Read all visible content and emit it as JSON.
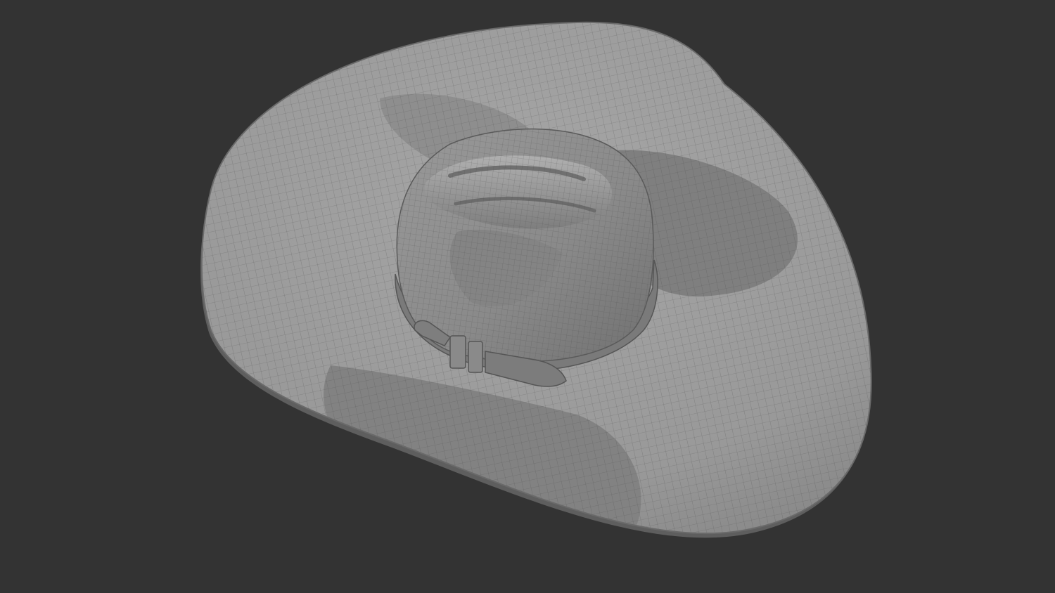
{
  "scene": {
    "subject": "wireframe-cowboy-hat-model",
    "colors": {
      "background": "#333333",
      "brim": "#9c9c9c",
      "brim_shadow": "#7c7c7c",
      "brim_edge": "#6a6a6a",
      "crown": "#8f8f8f",
      "crown_dark": "#6e6e6e",
      "band": "#7a7a7a",
      "wire": "#4c4c4c"
    }
  }
}
